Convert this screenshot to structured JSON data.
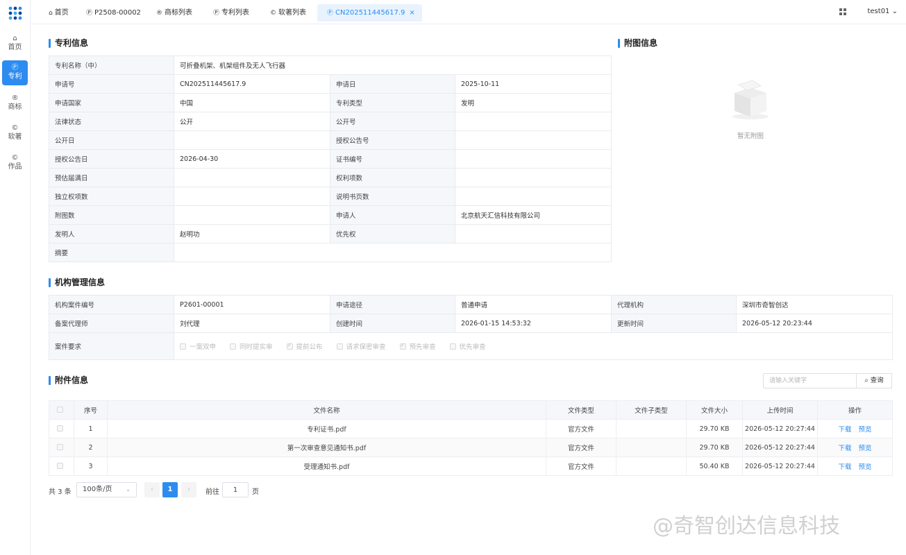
{
  "nav": {
    "items": [
      {
        "icon": "home-icon",
        "glyph": "⌂",
        "label": "首页"
      },
      {
        "icon": "patent-icon",
        "glyph": "Ⓟ",
        "label": "专利"
      },
      {
        "icon": "trademark-icon",
        "glyph": "®",
        "label": "商标"
      },
      {
        "icon": "software-copyright-icon",
        "glyph": "©",
        "label": "软著"
      },
      {
        "icon": "works-copyright-icon",
        "glyph": "©",
        "label": "作品"
      }
    ]
  },
  "tabs": [
    {
      "icon": "home-icon",
      "glyph": "⌂",
      "label": "首页"
    },
    {
      "icon": "patent-icon",
      "glyph": "Ⓟ",
      "label": "P2508-00002"
    },
    {
      "icon": "trademark-icon",
      "glyph": "®",
      "label": "商标列表"
    },
    {
      "icon": "patent-icon",
      "glyph": "Ⓟ",
      "label": "专利列表"
    },
    {
      "icon": "copyright-icon",
      "glyph": "©",
      "label": "软著列表"
    },
    {
      "icon": "patent-icon",
      "glyph": "Ⓟ",
      "label": "CN202511445617.9",
      "close": "×"
    }
  ],
  "user": {
    "name": "test01",
    "caret": "⌄"
  },
  "patent": {
    "title": "专利信息",
    "name_label": "专利名称（中）",
    "name_value": "可折叠机架、机架组件及无人飞行器",
    "rows": [
      [
        "申请号",
        "CN202511445617.9",
        "申请日",
        "2025-10-11"
      ],
      [
        "申请国家",
        "中国",
        "专利类型",
        "发明"
      ],
      [
        "法律状态",
        "公开",
        "公开号",
        ""
      ],
      [
        "公开日",
        "",
        "授权公告号",
        ""
      ],
      [
        "授权公告日",
        "2026-04-30",
        "证书编号",
        ""
      ],
      [
        "预估届满日",
        "",
        "权利项数",
        ""
      ],
      [
        "独立权项数",
        "",
        "说明书页数",
        ""
      ],
      [
        "附图数",
        "",
        "申请人",
        "北京航天汇信科技有限公司"
      ],
      [
        "发明人",
        "赵明功",
        "优先权",
        ""
      ]
    ],
    "abstract_label": "摘要",
    "abstract_value": ""
  },
  "figure": {
    "title": "附图信息",
    "empty_text": "暂无附图"
  },
  "agency": {
    "title": "机构管理信息",
    "rows": [
      [
        "机构案件编号",
        "P2601-00001",
        "申请途径",
        "普通申请",
        "代理机构",
        "深圳市奇智创达"
      ],
      [
        "备案代理师",
        "刘代理",
        "创建时间",
        "2026-01-15 14:53:32",
        "更新时间",
        "2026-05-12 20:23:44"
      ]
    ],
    "req_label": "案件要求",
    "requirements": [
      {
        "label": "一案双申",
        "checked": false
      },
      {
        "label": "同时提实审",
        "checked": false
      },
      {
        "label": "提前公布",
        "checked": true
      },
      {
        "label": "请求保密审查",
        "checked": false
      },
      {
        "label": "预先审查",
        "checked": true
      },
      {
        "label": "优先审查",
        "checked": false
      }
    ]
  },
  "attachments": {
    "title": "附件信息",
    "search_placeholder": "请输入关键字",
    "search_button": "查询",
    "search_icon": "⌕",
    "headers": [
      "序号",
      "文件名称",
      "文件类型",
      "文件子类型",
      "文件大小",
      "上传时间",
      "操作"
    ],
    "rows": [
      {
        "no": "1",
        "name": "专利证书.pdf",
        "type": "官方文件",
        "subtype": "",
        "size": "29.70 KB",
        "time": "2026-05-12 20:27:44"
      },
      {
        "no": "2",
        "name": "第一次审查意见通知书.pdf",
        "type": "官方文件",
        "subtype": "",
        "size": "29.70 KB",
        "time": "2026-05-12 20:27:44"
      },
      {
        "no": "3",
        "name": "受理通知书.pdf",
        "type": "官方文件",
        "subtype": "",
        "size": "50.40 KB",
        "time": "2026-05-12 20:27:44"
      }
    ],
    "download": "下载",
    "preview": "预览"
  },
  "pagination": {
    "total": "共 3 条",
    "page_size": "100条/页",
    "current_page": "1",
    "prev": "‹",
    "next": "›",
    "goto": "前往",
    "goto_value": "1",
    "page_unit": "页"
  },
  "watermark": "@奇智创达信息科技",
  "colors": {
    "accent": "#2d8cf0",
    "label_bg": "#f5f7fa"
  }
}
